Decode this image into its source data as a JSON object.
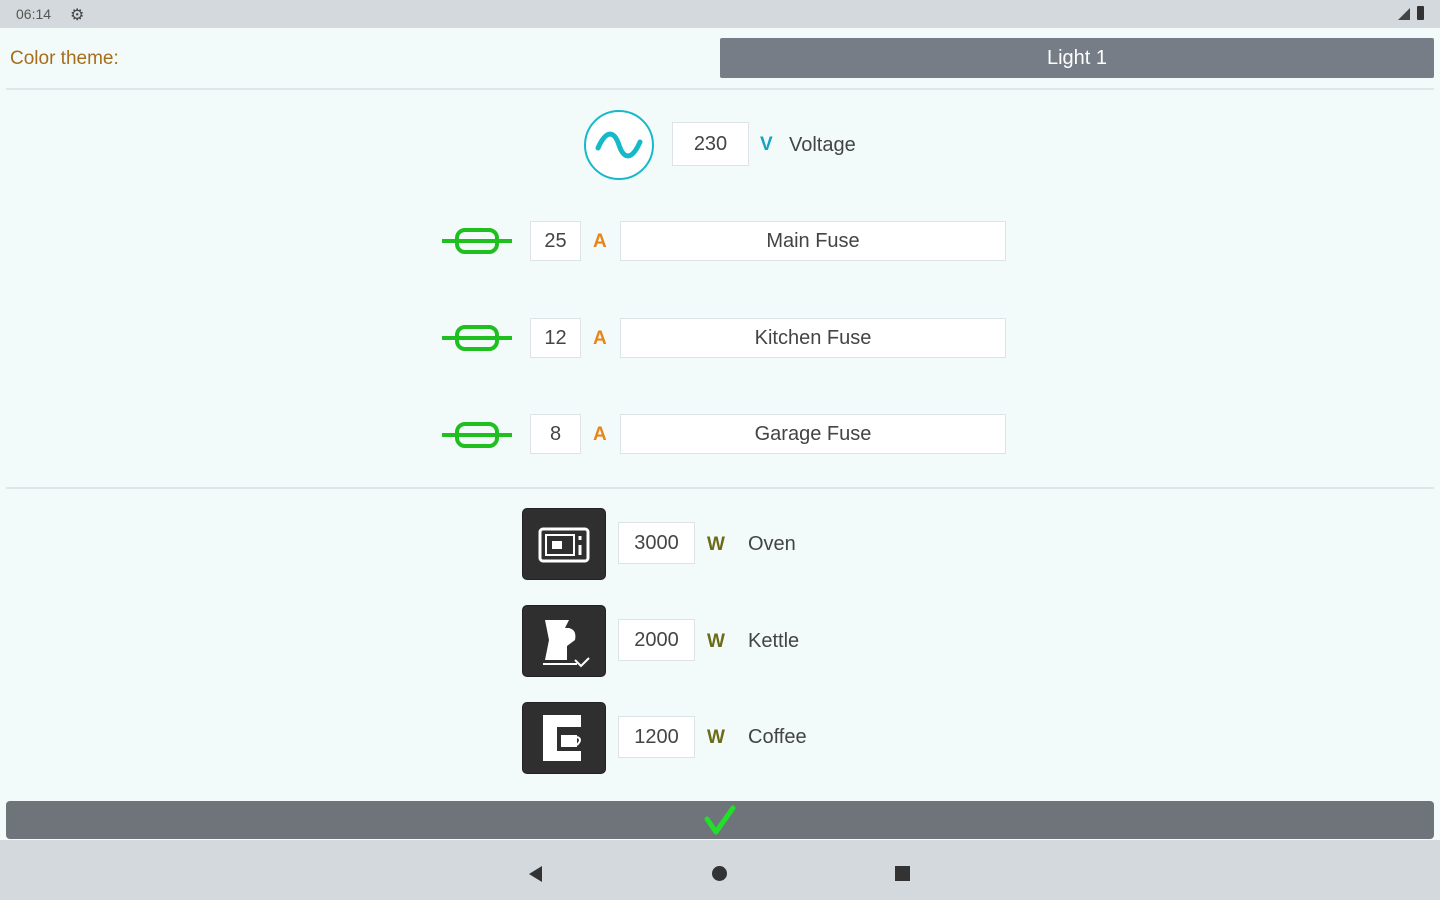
{
  "status_bar": {
    "time": "06:14"
  },
  "theme": {
    "label": "Color theme:",
    "selected": "Light 1"
  },
  "voltage": {
    "value": "230",
    "unit": "V",
    "label": "Voltage"
  },
  "fuses": [
    {
      "value": "25",
      "unit": "A",
      "name": "Main Fuse"
    },
    {
      "value": "12",
      "unit": "A",
      "name": "Kitchen Fuse"
    },
    {
      "value": "8",
      "unit": "A",
      "name": "Garage Fuse"
    }
  ],
  "appliances": [
    {
      "value": "3000",
      "unit": "W",
      "name": "Oven",
      "icon": "oven-icon"
    },
    {
      "value": "2000",
      "unit": "W",
      "name": "Kettle",
      "icon": "kettle-icon"
    },
    {
      "value": "1200",
      "unit": "W",
      "name": "Coffee",
      "icon": "coffee-maker-icon"
    }
  ],
  "colors": {
    "accent_voltage": "#17b9c9",
    "fuse_green": "#1fbf1f",
    "amp_orange": "#e8851a",
    "confirm_check": "#22e02a"
  }
}
